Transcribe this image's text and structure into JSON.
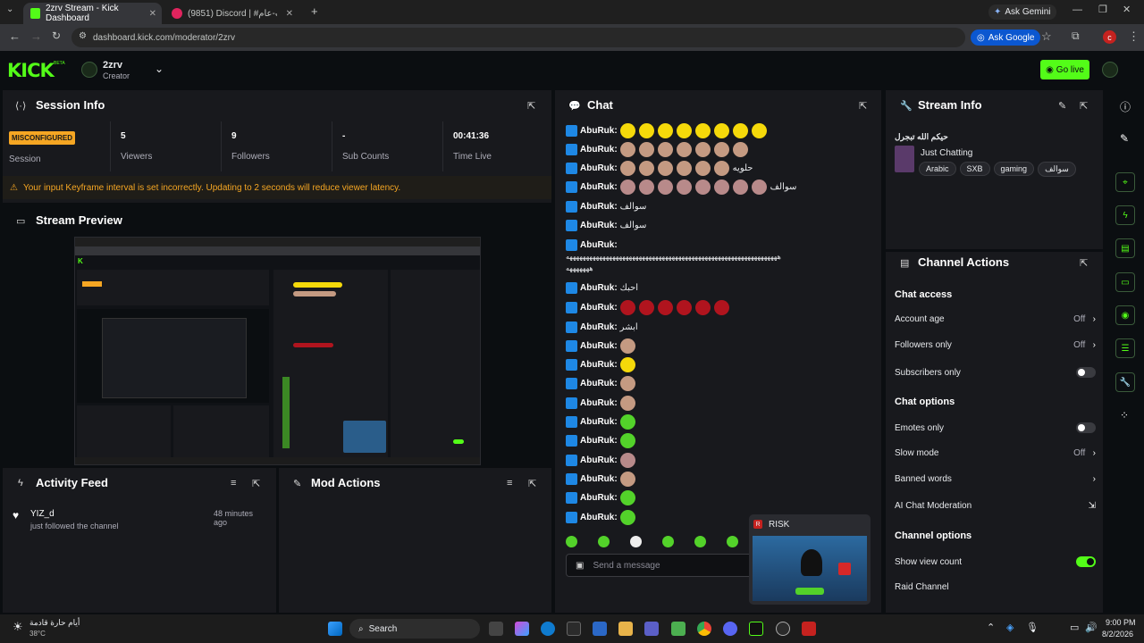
{
  "browser": {
    "tabs": [
      {
        "label": "2zrv Stream - Kick Dashboard",
        "active": true
      },
      {
        "label": "(9851) Discord | #شات-عام",
        "active": false
      }
    ],
    "url": "dashboard.kick.com/moderator/2zrv",
    "ask_gemini": "Ask Gemini",
    "ask_google": "Ask Google",
    "profile_initial": "c"
  },
  "header": {
    "logo": "KICK",
    "logo_badge": "BETA",
    "channel_name": "2zrv",
    "channel_role": "Creator",
    "go_live": "Go live"
  },
  "session": {
    "title": "Session Info",
    "badge": "MISCONFIGURED",
    "badge_label": "Session",
    "stats": [
      {
        "value": "5",
        "label": "Viewers"
      },
      {
        "value": "9",
        "label": "Followers"
      },
      {
        "value": "-",
        "label": "Sub Counts"
      },
      {
        "value": "00:41:36",
        "label": "Time Live"
      }
    ],
    "warning": "Your input Keyframe interval is set incorrectly. Updating to 2 seconds will reduce viewer latency."
  },
  "preview": {
    "title": "Stream Preview"
  },
  "activity": {
    "title": "Activity Feed",
    "items": [
      {
        "user": "YIZ_d",
        "text": "just followed the channel",
        "time": "48 minutes ago"
      }
    ]
  },
  "mod_actions": {
    "title": "Mod Actions"
  },
  "chat": {
    "title": "Chat",
    "user": "AbuRuk:",
    "rows": [
      {
        "text": "",
        "emotes": 8,
        "color": "#f5d90a"
      },
      {
        "text": "",
        "emotes": 7,
        "color": "#c49a82"
      },
      {
        "text": "حلويه",
        "emotes": 6,
        "color": "#c49a82"
      },
      {
        "text": "سوالف",
        "emotes": 8,
        "color": "#b88a8a"
      },
      {
        "text": "سوالف",
        "emotes": 0,
        "color": ""
      },
      {
        "text": "سوالف",
        "emotes": 0,
        "color": ""
      },
      {
        "text": "",
        "emotes": 0,
        "color": ""
      },
      {
        "text": "احبك",
        "emotes": 0,
        "color": ""
      },
      {
        "text": "",
        "emotes": 6,
        "color": "#b0141e"
      },
      {
        "text": "ابشر",
        "emotes": 0,
        "color": ""
      },
      {
        "text": "",
        "emotes": 1,
        "color": "#c49a82"
      },
      {
        "text": "",
        "emotes": 1,
        "color": "#f5d90a"
      },
      {
        "text": "",
        "emotes": 1,
        "color": "#c49a82"
      },
      {
        "text": "",
        "emotes": 1,
        "color": "#c49a82"
      },
      {
        "text": "",
        "emotes": 1,
        "color": "#53d22a"
      },
      {
        "text": "",
        "emotes": 1,
        "color": "#53d22a"
      },
      {
        "text": "",
        "emotes": 1,
        "color": "#b88a8a"
      },
      {
        "text": "",
        "emotes": 1,
        "color": "#c49a82"
      },
      {
        "text": "",
        "emotes": 1,
        "color": "#53d22a"
      },
      {
        "text": "",
        "emotes": 1,
        "color": "#53d22a"
      }
    ],
    "long_line_1": "ههههههههههههههههههههههههههههههههههههههههههههههههههههههههههههههههه",
    "long_line_2": "هههههههه",
    "input_placeholder": "Send a message"
  },
  "popup": {
    "title": "RISK"
  },
  "stream_info": {
    "title": "Stream Info",
    "stream_title": "حيكم الله تبجرل",
    "category": "Just Chatting",
    "tags": [
      "Arabic",
      "SXB",
      "gaming",
      "سوالف"
    ]
  },
  "channel_actions": {
    "title": "Channel Actions",
    "chat_access": "Chat access",
    "account_age": {
      "label": "Account age",
      "value": "Off"
    },
    "followers_only": {
      "label": "Followers only",
      "value": "Off"
    },
    "subscribers_only": {
      "label": "Subscribers only",
      "on": false
    },
    "chat_options": "Chat options",
    "emotes_only": {
      "label": "Emotes only",
      "on": false
    },
    "slow_mode": {
      "label": "Slow mode",
      "value": "Off"
    },
    "banned_words": "Banned words",
    "ai_mod": "AI Chat Moderation",
    "channel_options": "Channel options",
    "show_view_count": {
      "label": "Show view count",
      "on": true
    },
    "raid_channel": "Raid Channel"
  },
  "taskbar": {
    "weather_text": "أيام حارة قادمة",
    "temp": "38°C",
    "search": "Search",
    "time": "9:00 PM",
    "date": "8/2/2026"
  },
  "colors": {
    "accent": "#53fc18",
    "panel": "#18191d",
    "bg": "#0b0e11",
    "warn": "#f5a623"
  }
}
